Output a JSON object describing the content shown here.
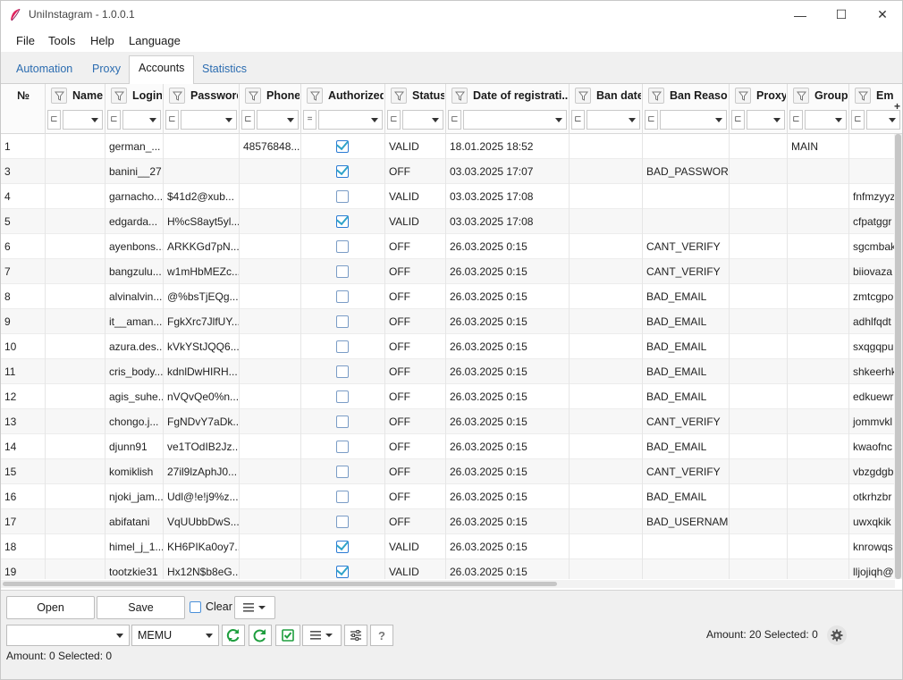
{
  "window": {
    "title": "UniInstagram - 1.0.0.1",
    "minimize": "—",
    "maximize": "☐",
    "close": "✕"
  },
  "menu": [
    "File",
    "Tools",
    "Help",
    "Language"
  ],
  "tabs": [
    {
      "label": "Automation",
      "active": false
    },
    {
      "label": "Proxy",
      "active": false
    },
    {
      "label": "Accounts",
      "active": true
    },
    {
      "label": "Statistics",
      "active": false
    }
  ],
  "table": {
    "columns": [
      {
        "label": "№",
        "filter": false
      },
      {
        "label": "Name",
        "filter": true,
        "op": "⊏"
      },
      {
        "label": "Login",
        "filter": true,
        "op": "⊏"
      },
      {
        "label": "Password",
        "filter": true,
        "op": "⊏"
      },
      {
        "label": "Phone",
        "filter": true,
        "op": "⊏"
      },
      {
        "label": "Authorized",
        "filter": true,
        "op": "="
      },
      {
        "label": "Status",
        "filter": true,
        "op": "⊏"
      },
      {
        "label": "Date of registrati...",
        "filter": true,
        "op": "⊏"
      },
      {
        "label": "Ban date",
        "filter": true,
        "op": "⊏"
      },
      {
        "label": "Ban Reason",
        "filter": true,
        "op": "⊏"
      },
      {
        "label": "Proxy",
        "filter": true,
        "op": "⊏"
      },
      {
        "label": "Group",
        "filter": true,
        "op": "⊏"
      },
      {
        "label": "Em",
        "filter": true,
        "op": "⊏"
      }
    ],
    "rows": [
      {
        "n": "1",
        "name": "",
        "login": "german_...",
        "password": "",
        "phone": "48576848...",
        "authorized": true,
        "status": "VALID",
        "date": "18.01.2025 18:52",
        "ban_date": "",
        "ban_reason": "",
        "proxy": "",
        "group": "MAIN",
        "email": ""
      },
      {
        "n": "3",
        "name": "",
        "login": "banini__27",
        "password": "",
        "phone": "",
        "authorized": true,
        "status": "OFF",
        "date": "03.03.2025 17:07",
        "ban_date": "",
        "ban_reason": "BAD_PASSWORD",
        "proxy": "",
        "group": "",
        "email": ""
      },
      {
        "n": "4",
        "name": "",
        "login": "garnacho...",
        "password": "$41d2@xub...",
        "phone": "",
        "authorized": false,
        "status": "VALID",
        "date": "03.03.2025 17:08",
        "ban_date": "",
        "ban_reason": "",
        "proxy": "",
        "group": "",
        "email": "fnfmzyyz"
      },
      {
        "n": "5",
        "name": "",
        "login": "edgarda...",
        "password": "H%cS8ayt5yl...",
        "phone": "",
        "authorized": true,
        "status": "VALID",
        "date": "03.03.2025 17:08",
        "ban_date": "",
        "ban_reason": "",
        "proxy": "",
        "group": "",
        "email": "cfpatggr"
      },
      {
        "n": "6",
        "name": "",
        "login": "ayenbons...",
        "password": "ARKKGd7pN...",
        "phone": "",
        "authorized": false,
        "status": "OFF",
        "date": "26.03.2025 0:15",
        "ban_date": "",
        "ban_reason": "CANT_VERIFY",
        "proxy": "",
        "group": "",
        "email": "sgcmbak"
      },
      {
        "n": "7",
        "name": "",
        "login": "bangzulu...",
        "password": "w1mHbMEZc...",
        "phone": "",
        "authorized": false,
        "status": "OFF",
        "date": "26.03.2025 0:15",
        "ban_date": "",
        "ban_reason": "CANT_VERIFY",
        "proxy": "",
        "group": "",
        "email": "biiovaza"
      },
      {
        "n": "8",
        "name": "",
        "login": "alvinalvin...",
        "password": "@%bsTjEQg...",
        "phone": "",
        "authorized": false,
        "status": "OFF",
        "date": "26.03.2025 0:15",
        "ban_date": "",
        "ban_reason": "BAD_EMAIL",
        "proxy": "",
        "group": "",
        "email": "zmtcgpo"
      },
      {
        "n": "9",
        "name": "",
        "login": "it__aman...",
        "password": "FgkXrc7JlfUY...",
        "phone": "",
        "authorized": false,
        "status": "OFF",
        "date": "26.03.2025 0:15",
        "ban_date": "",
        "ban_reason": "BAD_EMAIL",
        "proxy": "",
        "group": "",
        "email": "adhlfqdt"
      },
      {
        "n": "10",
        "name": "",
        "login": "azura.des...",
        "password": "kVkYStJQQ6...",
        "phone": "",
        "authorized": false,
        "status": "OFF",
        "date": "26.03.2025 0:15",
        "ban_date": "",
        "ban_reason": "BAD_EMAIL",
        "proxy": "",
        "group": "",
        "email": "sxqgqpu"
      },
      {
        "n": "11",
        "name": "",
        "login": "cris_body...",
        "password": "kdnlDwHIRH...",
        "phone": "",
        "authorized": false,
        "status": "OFF",
        "date": "26.03.2025 0:15",
        "ban_date": "",
        "ban_reason": "BAD_EMAIL",
        "proxy": "",
        "group": "",
        "email": "shkeerhk"
      },
      {
        "n": "12",
        "name": "",
        "login": "agis_suhe...",
        "password": "nVQvQe0%n...",
        "phone": "",
        "authorized": false,
        "status": "OFF",
        "date": "26.03.2025 0:15",
        "ban_date": "",
        "ban_reason": "BAD_EMAIL",
        "proxy": "",
        "group": "",
        "email": "edkuewr"
      },
      {
        "n": "13",
        "name": "",
        "login": "chongo.j...",
        "password": "FgNDvY7aDk...",
        "phone": "",
        "authorized": false,
        "status": "OFF",
        "date": "26.03.2025 0:15",
        "ban_date": "",
        "ban_reason": "CANT_VERIFY",
        "proxy": "",
        "group": "",
        "email": "jommvkl"
      },
      {
        "n": "14",
        "name": "",
        "login": "djunn91",
        "password": "ve1TOdIB2Jz...",
        "phone": "",
        "authorized": false,
        "status": "OFF",
        "date": "26.03.2025 0:15",
        "ban_date": "",
        "ban_reason": "BAD_EMAIL",
        "proxy": "",
        "group": "",
        "email": "kwaofnc"
      },
      {
        "n": "15",
        "name": "",
        "login": "komiklish",
        "password": "27il9lzAphJ0...",
        "phone": "",
        "authorized": false,
        "status": "OFF",
        "date": "26.03.2025 0:15",
        "ban_date": "",
        "ban_reason": "CANT_VERIFY",
        "proxy": "",
        "group": "",
        "email": "vbzgdgb"
      },
      {
        "n": "16",
        "name": "",
        "login": "njoki_jam...",
        "password": "Udl@!e!j9%z...",
        "phone": "",
        "authorized": false,
        "status": "OFF",
        "date": "26.03.2025 0:15",
        "ban_date": "",
        "ban_reason": "BAD_EMAIL",
        "proxy": "",
        "group": "",
        "email": "otkrhzbr"
      },
      {
        "n": "17",
        "name": "",
        "login": "abifatani",
        "password": "VqUUbbDwS...",
        "phone": "",
        "authorized": false,
        "status": "OFF",
        "date": "26.03.2025 0:15",
        "ban_date": "",
        "ban_reason": "BAD_USERNAME",
        "proxy": "",
        "group": "",
        "email": "uwxqkik"
      },
      {
        "n": "18",
        "name": "",
        "login": "himel_j_1...",
        "password": "KH6PIKa0oy7...",
        "phone": "",
        "authorized": true,
        "status": "VALID",
        "date": "26.03.2025 0:15",
        "ban_date": "",
        "ban_reason": "",
        "proxy": "",
        "group": "",
        "email": "knrowqs"
      },
      {
        "n": "19",
        "name": "",
        "login": "tootzkie31",
        "password": "Hx12N$b8eG...",
        "phone": "",
        "authorized": true,
        "status": "VALID",
        "date": "26.03.2025 0:15",
        "ban_date": "",
        "ban_reason": "",
        "proxy": "",
        "group": "",
        "email": "lljojiqh@"
      }
    ]
  },
  "bottom": {
    "open_label": "Open",
    "save_label": "Save",
    "clear_label": "Clear",
    "group_combo_value": "",
    "device_combo_value": "MEMU",
    "amount_right": "Amount: 20  Selected: 0",
    "amount_left": "Amount: 0  Selected: 0"
  },
  "colors": {
    "accent_tab_text": "#2b6cb0",
    "check_green": "#1e9e3e",
    "checkbox_blue": "#2fa3c9"
  }
}
